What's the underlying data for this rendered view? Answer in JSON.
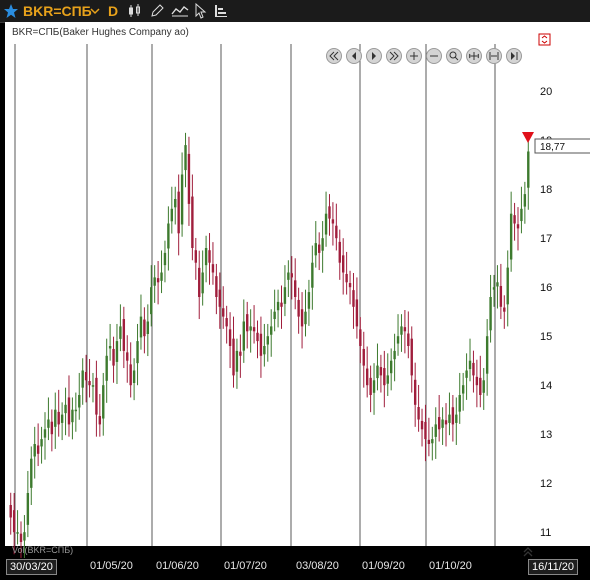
{
  "toolbar": {
    "symbol": "BKR=СПБ",
    "interval": "D",
    "star_icon": "star-icon",
    "colors": {
      "accent": "#e8a21b",
      "star": "#2a8de0"
    }
  },
  "chart": {
    "title": "BKR=СПБ(Baker Hughes Company ао)",
    "volume_label": "Vol(BKR=СПБ)",
    "last_price": "18,77",
    "start_date": "30/03/20",
    "end_date": "16/11/20",
    "colors": {
      "up": "#3d7a2e",
      "down": "#a01e3c",
      "grid": "#5a5a5a",
      "marker": "#e0101a"
    }
  },
  "chart_data": {
    "type": "candlestick",
    "title": "BKR=СПБ(Baker Hughes Company ао)",
    "y_ticks": [
      "11",
      "12",
      "13",
      "14",
      "15",
      "16",
      "17",
      "18",
      "19",
      "20"
    ],
    "ylim": [
      10.8,
      20.8
    ],
    "x_tick_labels": [
      "01/05/20",
      "01/06/20",
      "01/07/20",
      "03/08/20",
      "01/09/20",
      "01/10/20"
    ],
    "x_range": [
      "30/03/20",
      "16/11/20"
    ],
    "last_value": 18.77,
    "close": [
      11.3,
      11.0,
      11.0,
      10.8,
      11.0,
      11.8,
      12.5,
      12.8,
      12.6,
      12.9,
      13.1,
      13.3,
      13.0,
      13.5,
      13.2,
      13.4,
      13.6,
      13.2,
      13.5,
      13.5,
      13.8,
      14.3,
      14.1,
      14.0,
      14.0,
      13.4,
      13.2,
      14.0,
      14.6,
      14.8,
      14.4,
      14.9,
      15.2,
      14.7,
      14.5,
      14.0,
      14.3,
      14.9,
      15.4,
      15.0,
      15.3,
      16.0,
      16.2,
      16.1,
      16.3,
      16.7,
      17.3,
      17.6,
      17.8,
      17.1,
      18.3,
      18.9,
      17.7,
      16.8,
      16.5,
      15.8,
      16.3,
      16.8,
      16.5,
      16.3,
      15.8,
      15.6,
      15.4,
      15.2,
      14.8,
      14.2,
      14.7,
      14.6,
      15.3,
      15.1,
      15.2,
      15.1,
      14.9,
      14.6,
      14.8,
      15.0,
      15.2,
      15.5,
      15.7,
      15.6,
      16.0,
      16.3,
      16.2,
      15.8,
      15.4,
      15.2,
      15.5,
      15.9,
      16.5,
      16.9,
      16.7,
      17.0,
      17.5,
      17.4,
      17.3,
      17.0,
      16.5,
      16.3,
      16.1,
      16.0,
      15.6,
      15.2,
      14.8,
      14.4,
      14.0,
      13.8,
      14.1,
      14.4,
      14.2,
      14.0,
      14.2,
      14.5,
      14.7,
      15.0,
      15.2,
      15.1,
      14.8,
      14.2,
      13.6,
      13.3,
      13.1,
      12.9,
      12.8,
      12.9,
      13.2,
      13.1,
      13.3,
      13.2,
      13.4,
      13.2,
      13.4,
      13.8,
      14.0,
      14.3,
      14.5,
      14.2,
      14.0,
      13.8,
      14.1,
      15.0,
      15.8,
      16.0,
      16.1,
      15.6,
      15.5,
      16.4,
      17.5,
      17.3,
      17.2,
      17.6,
      17.9,
      18.77
    ]
  }
}
